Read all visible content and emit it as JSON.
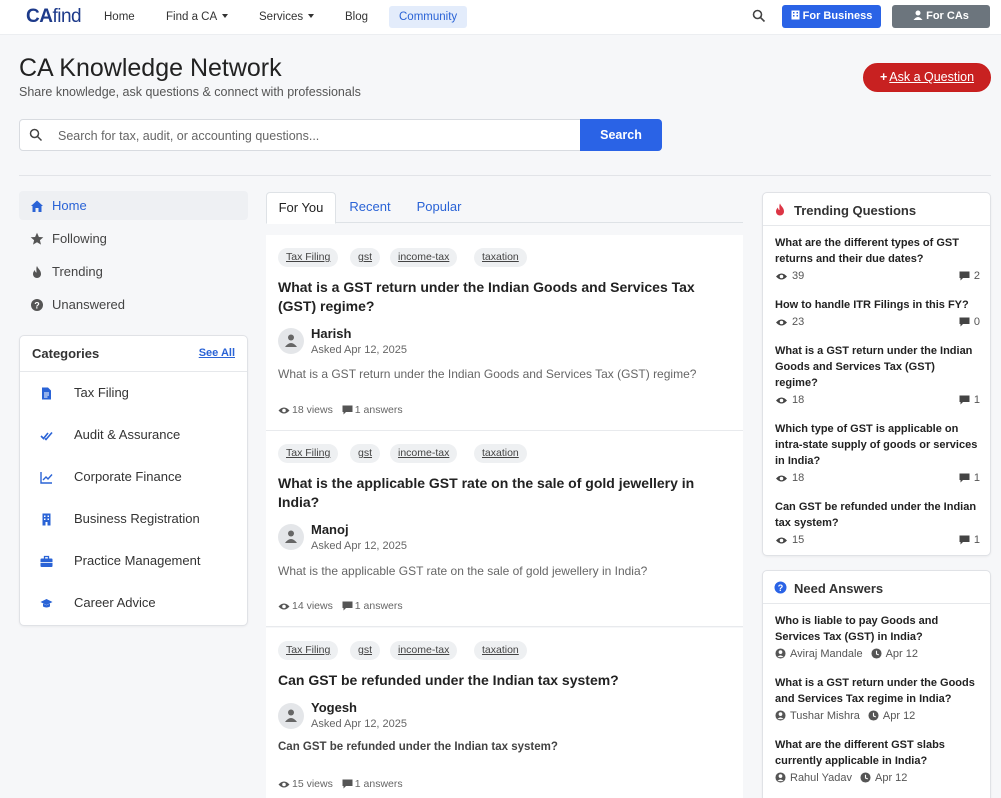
{
  "nav": {
    "logo_a": "CA",
    "logo_b": "find",
    "links": [
      "Home",
      "Find a CA",
      "Services",
      "Blog",
      "Community"
    ],
    "for_business": "For Business",
    "for_cas": "For CAs"
  },
  "header": {
    "title": "CA Knowledge Network",
    "subtitle": "Share knowledge, ask questions & connect with professionals",
    "ask_button": "Ask a Question",
    "search_placeholder": "Search for tax, audit, or accounting questions...",
    "search_button": "Search"
  },
  "sidebar": {
    "items": [
      "Home",
      "Following",
      "Trending",
      "Unanswered"
    ],
    "categories_title": "Categories",
    "see_all": "See All",
    "categories": [
      "Tax Filing",
      "Audit & Assurance",
      "Corporate Finance",
      "Business Registration",
      "Practice Management",
      "Career Advice"
    ]
  },
  "tabs": [
    "For You",
    "Recent",
    "Popular"
  ],
  "questions": [
    {
      "tags": [
        "Tax Filing",
        "gst",
        "income-tax",
        "taxation"
      ],
      "title": "What is a GST return under the Indian Goods and Services Tax (GST) regime?",
      "user": "Harish",
      "asked": "Asked Apr 12, 2025",
      "body": "What is a GST return under the Indian Goods and Services Tax (GST) regime?",
      "views": "18 views",
      "answers": "1 answers"
    },
    {
      "tags": [
        "Tax Filing",
        "gst",
        "income-tax",
        "taxation"
      ],
      "title": "What is the applicable GST rate on the sale of gold jewellery in India?",
      "user": "Manoj",
      "asked": "Asked Apr 12, 2025",
      "body": "What is the applicable GST rate on the sale of gold jewellery in India?",
      "views": "14 views",
      "answers": "1 answers"
    },
    {
      "tags": [
        "Tax Filing",
        "gst",
        "income-tax",
        "taxation"
      ],
      "title": "Can GST be refunded under the Indian tax system?",
      "user": "Yogesh",
      "asked": "Asked Apr 12, 2025",
      "body": "Can GST be refunded under the Indian tax system?",
      "views": "15 views",
      "answers": "1 answers"
    }
  ],
  "trending": {
    "title": "Trending Questions",
    "items": [
      {
        "q": "What are the different types of GST returns and their due dates?",
        "views": "39",
        "answers": "2"
      },
      {
        "q": "How to handle ITR Filings in this FY?",
        "views": "23",
        "answers": "0"
      },
      {
        "q": "What is a GST return under the Indian Goods and Services Tax (GST) regime?",
        "views": "18",
        "answers": "1"
      },
      {
        "q": "Which type of GST is applicable on intra-state supply of goods or services in India?",
        "views": "18",
        "answers": "1"
      },
      {
        "q": "Can GST be refunded under the Indian tax system?",
        "views": "15",
        "answers": "1"
      }
    ]
  },
  "need_answers": {
    "title": "Need Answers",
    "items": [
      {
        "q": "Who is liable to pay Goods and Services Tax (GST) in India?",
        "user": "Aviraj Mandale",
        "date": "Apr 12"
      },
      {
        "q": "What is a GST return under the Goods and Services Tax regime in India?",
        "user": "Tushar Mishra",
        "date": "Apr 12"
      },
      {
        "q": "What are the different GST slabs currently applicable in India?",
        "user": "Rahul Yadav",
        "date": "Apr 12"
      }
    ]
  },
  "colors": {
    "primary": "#2a63e6",
    "danger": "#c82121",
    "secondary": "#6c757d"
  }
}
